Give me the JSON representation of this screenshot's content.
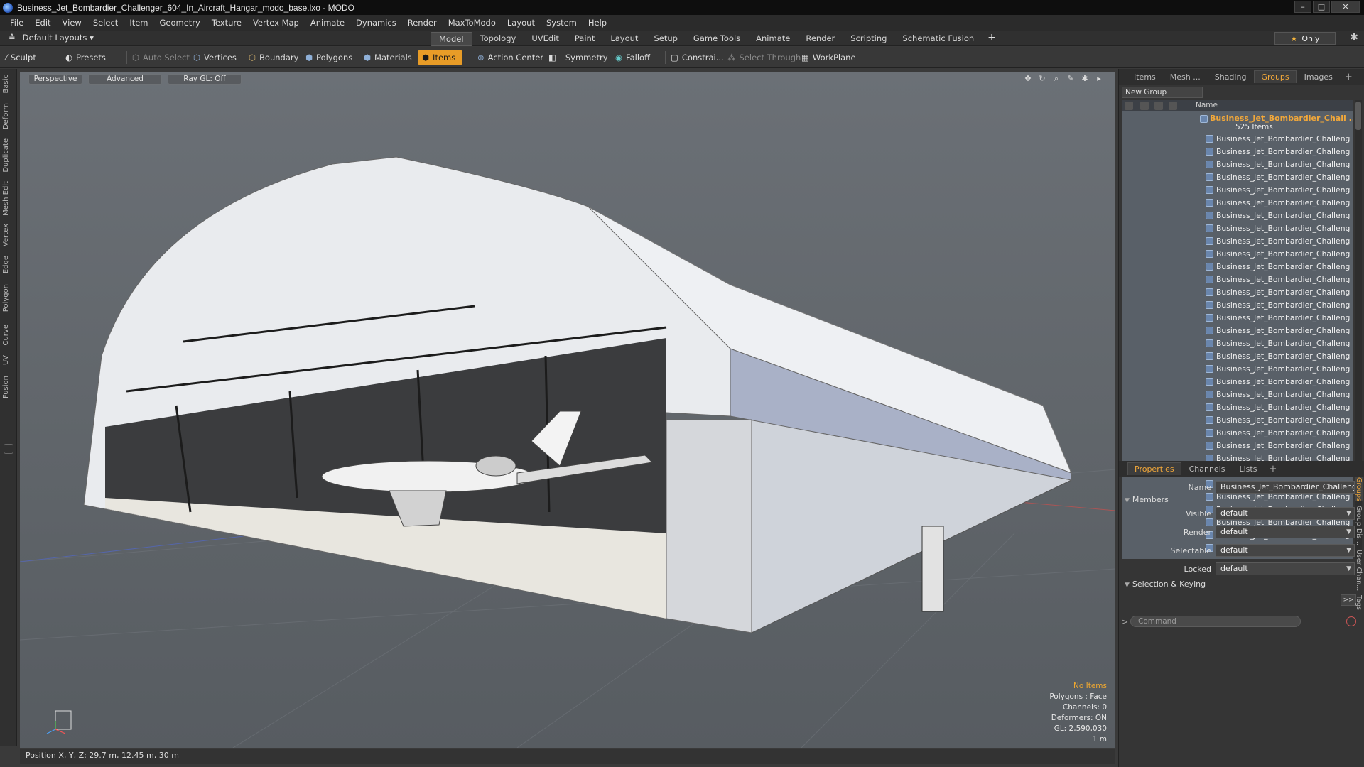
{
  "window": {
    "title": "Business_Jet_Bombardier_Challenger_604_In_Aircraft_Hangar_modo_base.lxo - MODO",
    "buttons": [
      "–",
      "□",
      "✕"
    ]
  },
  "menu": [
    "File",
    "Edit",
    "View",
    "Select",
    "Item",
    "Geometry",
    "Texture",
    "Vertex Map",
    "Animate",
    "Dynamics",
    "Render",
    "MaxToModo",
    "Layout",
    "System",
    "Help"
  ],
  "layouts": {
    "label": "Default Layouts"
  },
  "modes": {
    "tabs": [
      "Model",
      "Topology",
      "UVEdit",
      "Paint",
      "Layout",
      "Setup",
      "Game Tools",
      "Animate",
      "Render",
      "Scripting",
      "Schematic Fusion"
    ],
    "active": "Model",
    "only_label": "Only"
  },
  "toolbar": {
    "sculpt": "Sculpt",
    "presets": "Presets",
    "auto_select": "Auto Select",
    "vertices": "Vertices",
    "boundary": "Boundary",
    "polygons": "Polygons",
    "materials": "Materials",
    "items": "Items",
    "action_center": "Action Center",
    "symmetry": "Symmetry",
    "falloff": "Falloff",
    "constraints": "Constrai...",
    "select_through": "Select Through",
    "workplane": "WorkPlane"
  },
  "left_tabs": [
    "Basic",
    "Deform",
    "Duplicate",
    "Mesh Edit",
    "Vertex",
    "Edge",
    "Polygon",
    "Curve",
    "UV",
    "Fusion"
  ],
  "viewport": {
    "view": "Perspective",
    "style": "Advanced",
    "raygl": "Ray GL: Off",
    "info": {
      "selection": "No Items",
      "polygons": "Polygons : Face",
      "channels": "Channels: 0",
      "deformers": "Deformers: ON",
      "gl": "GL: 2,590,030",
      "scale": "1 m"
    }
  },
  "status": {
    "position": "Position X, Y, Z:  29.7 m, 12.45 m, 30 m"
  },
  "panel_tabs": [
    "Items",
    "Mesh ...",
    "Shading",
    "Groups",
    "Images"
  ],
  "panel_active": "Groups",
  "groups": {
    "new_group": "New Group",
    "name_header": "Name",
    "group_name": "Business_Jet_Bombardier_Chall ...",
    "group_count": "525 Items",
    "children": [
      "Business_Jet_Bombardier_Challeng ...",
      "Business_Jet_Bombardier_Challeng ...",
      "Business_Jet_Bombardier_Challeng ...",
      "Business_Jet_Bombardier_Challeng ...",
      "Business_Jet_Bombardier_Challeng ...",
      "Business_Jet_Bombardier_Challeng ...",
      "Business_Jet_Bombardier_Challeng ...",
      "Business_Jet_Bombardier_Challeng ...",
      "Business_Jet_Bombardier_Challeng ...",
      "Business_Jet_Bombardier_Challeng ...",
      "Business_Jet_Bombardier_Challeng ...",
      "Business_Jet_Bombardier_Challeng ...",
      "Business_Jet_Bombardier_Challeng ...",
      "Business_Jet_Bombardier_Challeng ...",
      "Business_Jet_Bombardier_Challeng ...",
      "Business_Jet_Bombardier_Challeng ...",
      "Business_Jet_Bombardier_Challeng ...",
      "Business_Jet_Bombardier_Challeng ...",
      "Business_Jet_Bombardier_Challeng ...",
      "Business_Jet_Bombardier_Challeng ...",
      "Business_Jet_Bombardier_Challeng ...",
      "Business_Jet_Bombardier_Challeng ...",
      "Business_Jet_Bombardier_Challeng ...",
      "Business_Jet_Bombardier_Challeng ...",
      "Business_Jet_Bombardier_Challeng ...",
      "Business_Jet_Bombardier_Challeng ...",
      "Business_Jet_Bombardier_Challeng ...",
      "Business_Jet_Bombardier_Challeng ...",
      "Business_Jet_Bombardier_Challeng ...",
      "Business_Jet_Bombardier_Challeng ...",
      "Business_Jet_Bombardier_Challeng ...",
      "Business_Jet_Bombardier_Challeng ...",
      "Business_Jet_Bombardier_Challeng ..."
    ]
  },
  "props_tabs": [
    "Properties",
    "Channels",
    "Lists"
  ],
  "props_active": "Properties",
  "properties": {
    "name_label": "Name",
    "name_value": "Business_Jet_Bombardier_Challenger_",
    "members": "Members",
    "visible_label": "Visible",
    "visible": "default",
    "render_label": "Render",
    "render": "default",
    "selectable_label": "Selectable",
    "selectable": "default",
    "locked_label": "Locked",
    "locked": "default",
    "selection_keying": "Selection & Keying",
    "arrows": ">>"
  },
  "side_tabs": [
    "Groups",
    "Group Dis...",
    "User Chan...",
    "Tags"
  ],
  "command": {
    "placeholder": "Command"
  },
  "colors": {
    "accent": "#e89c27",
    "group_text": "#f2a83a",
    "viewport_bg": "#61666b"
  }
}
